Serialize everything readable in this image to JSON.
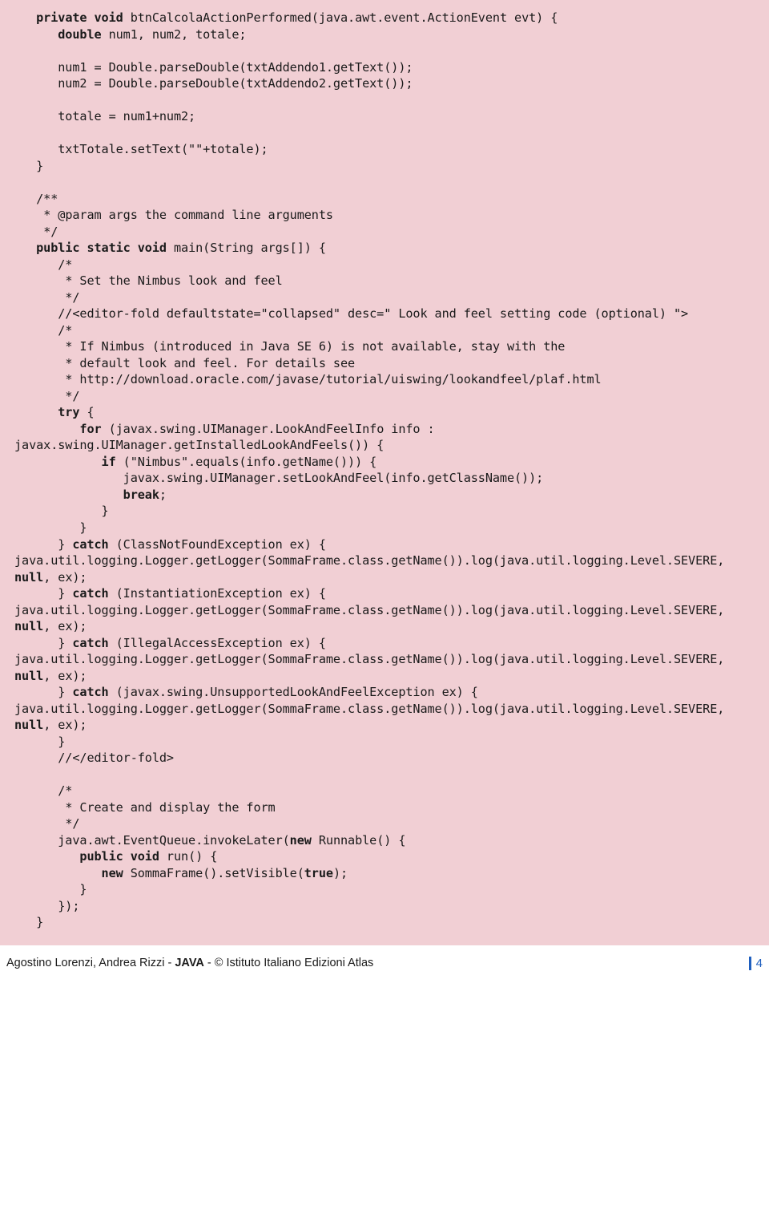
{
  "footer": {
    "authors": "Agostino Lorenzi, Andrea Rizzi - ",
    "lang": "JAVA",
    "publisher": " - © Istituto Italiano Edizioni Atlas",
    "page": "4"
  },
  "code": {
    "l1a": "   private void",
    "l1b": " btnCalcolaActionPerformed(java.awt.event.ActionEvent evt) {",
    "l2a": "      double",
    "l2b": " num1, num2, totale;",
    "l3": "",
    "l4": "      num1 = Double.parseDouble(txtAddendo1.getText());",
    "l5": "      num2 = Double.parseDouble(txtAddendo2.getText());",
    "l6": "",
    "l7": "      totale = num1+num2;",
    "l8": "",
    "l9": "      txtTotale.setText(\"\"+totale);",
    "l10": "   }",
    "l11": "",
    "l12": "   /**",
    "l13": "    * @param args the command line arguments",
    "l14": "    */",
    "l15a": "   public static void",
    "l15b": " main(String args[]) {",
    "l16": "      /*",
    "l17": "       * Set the Nimbus look and feel",
    "l18": "       */",
    "l19": "      //<editor-fold defaultstate=\"collapsed\" desc=\" Look and feel setting code (optional) \">",
    "l20": "      /*",
    "l21": "       * If Nimbus (introduced in Java SE 6) is not available, stay with the",
    "l22": "       * default look and feel. For details see",
    "l23": "       * http://download.oracle.com/javase/tutorial/uiswing/lookandfeel/plaf.html",
    "l24": "       */",
    "l25a": "      try",
    "l25b": " {",
    "l26a": "         for",
    "l26b": " (javax.swing.UIManager.LookAndFeelInfo info :",
    "l27": "javax.swing.UIManager.getInstalledLookAndFeels()) {",
    "l28a": "            if",
    "l28b": " (\"Nimbus\".equals(info.getName())) {",
    "l29": "               javax.swing.UIManager.setLookAndFeel(info.getClassName());",
    "l30a": "               break",
    "l30b": ";",
    "l31": "            }",
    "l32": "         }",
    "l33a": "      } ",
    "l33b": "catch",
    "l33c": " (ClassNotFoundException ex) {",
    "l34": "java.util.logging.Logger.getLogger(SommaFrame.class.getName()).log(java.util.logging.Level.SEVERE,",
    "l35a": "null",
    "l35b": ", ex);",
    "l36a": "      } ",
    "l36b": "catch",
    "l36c": " (InstantiationException ex) {",
    "l37": "java.util.logging.Logger.getLogger(SommaFrame.class.getName()).log(java.util.logging.Level.SEVERE,",
    "l38a": "null",
    "l38b": ", ex);",
    "l39a": "      } ",
    "l39b": "catch",
    "l39c": " (IllegalAccessException ex) {",
    "l40": "java.util.logging.Logger.getLogger(SommaFrame.class.getName()).log(java.util.logging.Level.SEVERE,",
    "l41a": "null",
    "l41b": ", ex);",
    "l42a": "      } ",
    "l42b": "catch",
    "l42c": " (javax.swing.UnsupportedLookAndFeelException ex) {",
    "l43": "java.util.logging.Logger.getLogger(SommaFrame.class.getName()).log(java.util.logging.Level.SEVERE,",
    "l44a": "null",
    "l44b": ", ex);",
    "l45": "      }",
    "l46": "      //</editor-fold>",
    "l47": "",
    "l48": "      /*",
    "l49": "       * Create and display the form",
    "l50": "       */",
    "l51a": "      java.awt.EventQueue.invokeLater(",
    "l51b": "new",
    "l51c": " Runnable() {",
    "l52a": "         public void",
    "l52b": " run() {",
    "l53a": "            new",
    "l53b": " SommaFrame().setVisible(",
    "l53c": "true",
    "l53d": ");",
    "l54": "         }",
    "l55": "      });",
    "l56": "   }"
  }
}
